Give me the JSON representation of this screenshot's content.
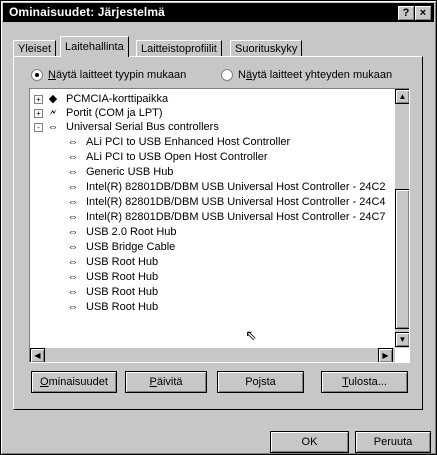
{
  "window": {
    "title": "Ominaisuudet: Järjestelmä",
    "help_label": "?",
    "close_label": "×"
  },
  "tabs": [
    {
      "label": "Yleiset"
    },
    {
      "label": "Laitehallinta"
    },
    {
      "label": "Laitteistoprofiilit"
    },
    {
      "label": "Suorituskyky"
    }
  ],
  "view_options": {
    "by_type": {
      "access": "N",
      "rest": "äytä laitteet tyypin mukaan",
      "selected": true
    },
    "by_connection": {
      "pre": "N",
      "access": "ä",
      "rest": "ytä laitteet yhteyden mukaan",
      "selected": false
    }
  },
  "tree": {
    "items": [
      {
        "label": "PCMCIA-korttipaikka",
        "toggle": "+"
      },
      {
        "label": "Portit (COM ja LPT)",
        "toggle": "+"
      },
      {
        "label": "Universal Serial Bus controllers",
        "toggle": "-"
      },
      {
        "label": "ALi PCI to USB Enhanced Host Controller"
      },
      {
        "label": "ALi PCI to USB Open Host Controller"
      },
      {
        "label": "Generic USB Hub"
      },
      {
        "label": "Intel(R) 82801DB/DBM USB Universal Host Controller - 24C2"
      },
      {
        "label": "Intel(R) 82801DB/DBM USB Universal Host Controller - 24C4"
      },
      {
        "label": "Intel(R) 82801DB/DBM USB Universal Host Controller - 24C7"
      },
      {
        "label": "USB 2.0 Root Hub"
      },
      {
        "label": "USB Bridge Cable"
      },
      {
        "label": "USB Root Hub"
      },
      {
        "label": "USB Root Hub"
      },
      {
        "label": "USB Root Hub"
      },
      {
        "label": "USB Root Hub"
      }
    ]
  },
  "actions": {
    "properties": {
      "access": "O",
      "rest": "minaisuudet"
    },
    "refresh": {
      "access": "P",
      "rest": "äivitä"
    },
    "remove": {
      "label": "Pojsta"
    },
    "print": {
      "access": "T",
      "rest": "ulosta..."
    }
  },
  "footer": {
    "ok_label": "OK",
    "cancel_label": "Peruuta"
  },
  "colors": {
    "titlebar": "#000000",
    "face": "#c7c7c7",
    "window": "#ffffff"
  }
}
